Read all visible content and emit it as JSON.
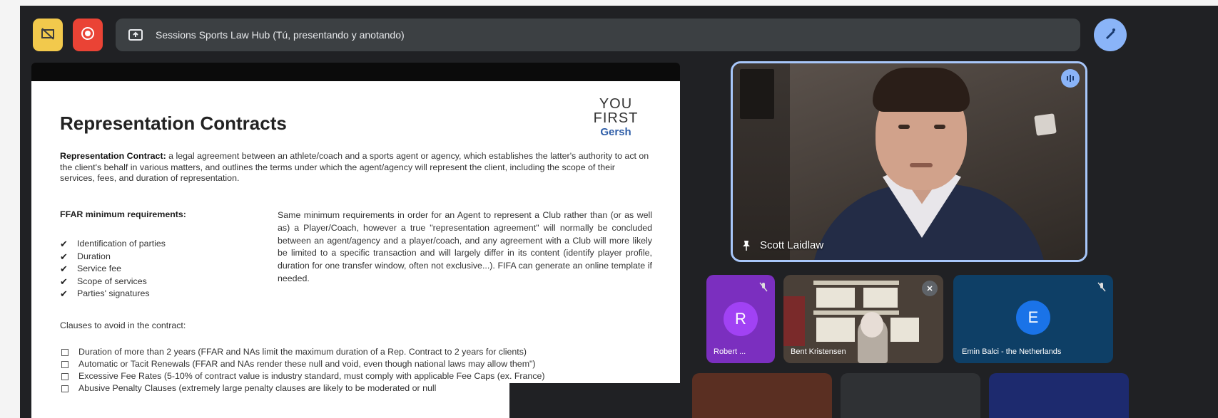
{
  "presentation_bar": {
    "title": "Sessions Sports Law Hub (Tú, presentando y anotando)"
  },
  "slide": {
    "title": "Representation Contracts",
    "logo": {
      "line1": "YOU",
      "line2": "FIRST",
      "line3": "Gersh"
    },
    "definition_term": "Representation Contract:",
    "definition_body": " a legal agreement between an athlete/coach and a sports agent or agency, which establishes the latter's authority to act on the client's behalf in various matters, and outlines the terms under which the agent/agency will represent the client, including the scope of their services, fees, and duration of representation.",
    "requirements_title": "FFAR minimum requirements:",
    "requirements": [
      "Identification of parties",
      "Duration",
      "Service fee",
      "Scope of services",
      "Parties' signatures"
    ],
    "agent_text": "Same minimum requirements in order for an Agent to represent a Club rather than (or as well as) a Player/Coach, however a true \"representation agreement\" will normally be concluded between an agent/agency and a player/coach, and any agreement with a Club will more likely be limited to a specific transaction and will largely differ in its content (identify player profile, duration for one transfer window, often not exclusive...). FIFA can generate an online template if needed.",
    "clauses_title": "Clauses to avoid in the contract:",
    "clauses": [
      "Duration of more than 2 years (FFAR and NAs limit the maximum duration of a Rep. Contract to 2 years for clients)",
      "Automatic or Tacit Renewals (FFAR and NAs render these null and void, even though national laws may allow them\")",
      "Excessive Fee Rates (5-10% of contract value is industry standard, must comply with applicable Fee Caps (ex. France)",
      "Abusive Penalty Clauses (extremely large penalty clauses are likely to be moderated or null"
    ]
  },
  "speaker": {
    "name": "Scott Laidlaw"
  },
  "participants": [
    {
      "initial": "R",
      "name": "Robert ..."
    },
    {
      "name": "Bent Kristensen"
    },
    {
      "initial": "E",
      "name": "Emin Balci - the Netherlands"
    }
  ],
  "colors": {
    "accent": "#8ab4f8",
    "camera_button": "#f2c94c",
    "record_button": "#ea4335",
    "speaker_border": "#a8c7fa",
    "tile_purple": "#7b2fbf",
    "tile_blue": "#0e3f66"
  }
}
